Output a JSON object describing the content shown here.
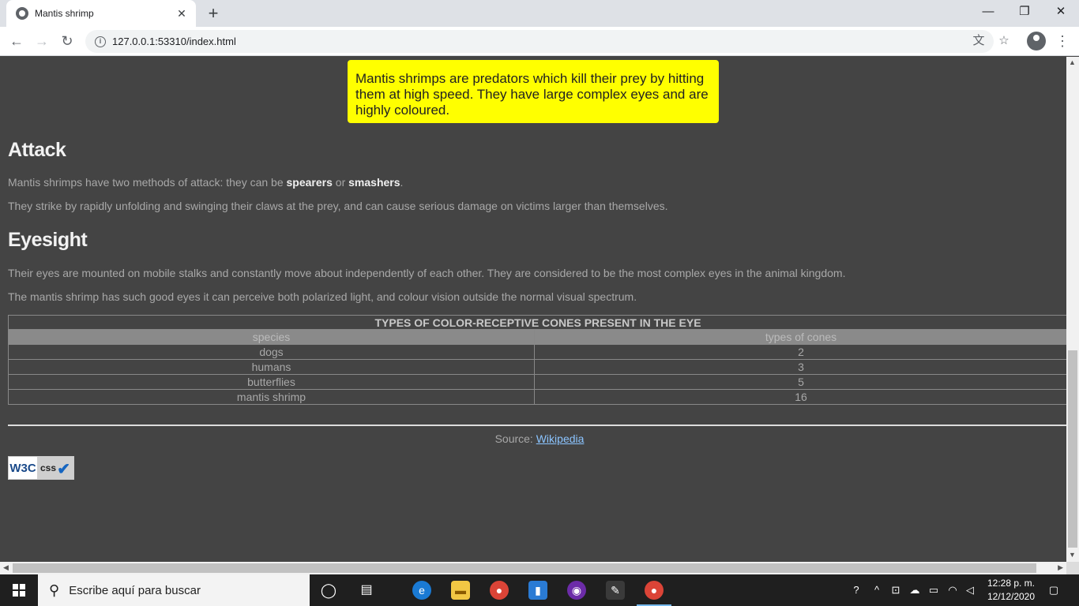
{
  "browser": {
    "tab_title": "Mantis shrimp",
    "tab_close": "✕",
    "new_tab": "+",
    "url": "127.0.0.1:53310/index.html",
    "win_minimize": "—",
    "win_restore": "❐",
    "win_close": "✕",
    "back": "←",
    "forward": "→",
    "reload": "↻",
    "translate": "文",
    "bookmark": "☆",
    "menu": "⋮"
  },
  "page": {
    "callout": "Mantis shrimps are predators which kill their prey by hitting them at high speed. They have large complex eyes and are highly coloured.",
    "attack": {
      "heading": "Attack",
      "p1_prefix": "Mantis shrimps have two methods of attack: they can be ",
      "p1_bold1": "spearers",
      "p1_mid": " or ",
      "p1_bold2": "smashers",
      "p1_suffix": ".",
      "p2": "They strike by rapidly unfolding and swinging their claws at the prey, and can cause serious damage on victims larger than themselves."
    },
    "eyesight": {
      "heading": "Eyesight",
      "p1": "Their eyes are mounted on mobile stalks and constantly move about independently of each other. They are considered to be the most complex eyes in the animal kingdom.",
      "p2": "The mantis shrimp has such good eyes it can perceive both polarized light, and colour vision outside the normal visual spectrum."
    },
    "table": {
      "caption": "TYPES OF COLOR-RECEPTIVE CONES PRESENT IN THE EYE",
      "headers": [
        "species",
        "types of cones"
      ],
      "rows": [
        [
          "dogs",
          "2"
        ],
        [
          "humans",
          "3"
        ],
        [
          "butterflies",
          "5"
        ],
        [
          "mantis shrimp",
          "16"
        ]
      ]
    },
    "source_label": "Source: ",
    "source_link": "Wikipedia",
    "badge_w3c": "W3C",
    "badge_css": "css"
  },
  "taskbar": {
    "search_placeholder": "Escribe aquí para buscar",
    "time": "12:28 p. m.",
    "date": "12/12/2020"
  }
}
